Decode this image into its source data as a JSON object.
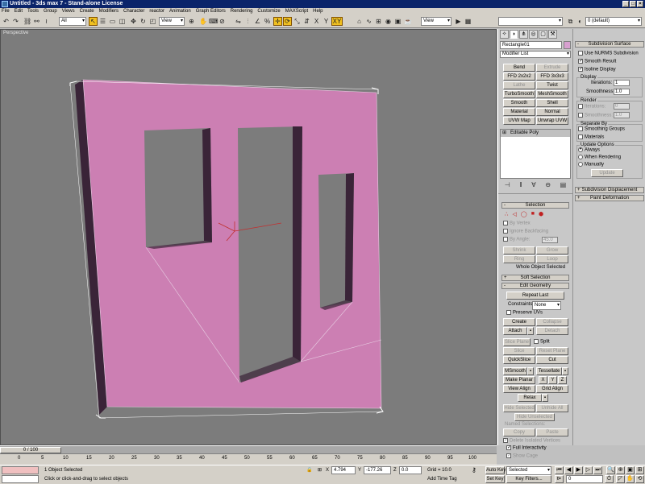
{
  "window": {
    "title": "Untitled - 3ds max 7 - Stand-alone License"
  },
  "menu": [
    "File",
    "Edit",
    "Tools",
    "Group",
    "Views",
    "Create",
    "Modifiers",
    "Character",
    "reactor",
    "Animation",
    "Graph Editors",
    "Rendering",
    "Customize",
    "MAXScript",
    "Help"
  ],
  "toolbar": {
    "filter": "All",
    "ref_coord": "View",
    "ref_coord2": "View",
    "layer": "0 (default)",
    "xy_label": "XY"
  },
  "viewport": {
    "label": "Perspective",
    "object_color": "#cc7fb3"
  },
  "command_panel": {
    "object_name": "Rectangle01",
    "modifier_list": "Modifier List",
    "buttons": [
      [
        "Bend",
        "Extrude"
      ],
      [
        "FFD 2x2x2",
        "FFD 3x3x3"
      ],
      [
        "Lathe",
        "Twist"
      ],
      [
        "TurboSmooth",
        "MeshSmooth"
      ],
      [
        "Smooth",
        "Shell"
      ],
      [
        "Material",
        "Normal"
      ],
      [
        "UVW Map",
        "Unwrap UVW"
      ]
    ],
    "stack_item": "Editable Poly",
    "selection": {
      "title": "Selection",
      "by_vertex": "By Vertex",
      "ignore_backfacing": "Ignore Backfacing",
      "by_angle": "By Angle:",
      "angle_value": "45.0",
      "shrink": "Shrink",
      "grow": "Grow",
      "ring": "Ring",
      "loop": "Loop",
      "status": "Whole Object Selected"
    },
    "soft_selection": "Soft Selection",
    "edit_geometry": {
      "title": "Edit Geometry",
      "repeat_last": "Repeat Last",
      "constraints_label": "Constraints:",
      "constraints_value": "None",
      "preserve_uvs": "Preserve UVs",
      "create": "Create",
      "collapse": "Collapse",
      "attach": "Attach",
      "detach": "Detach",
      "slice_plane": "Slice Plane",
      "split": "Split",
      "slice": "Slice",
      "reset_plane": "Reset Plane",
      "quickslice": "QuickSlice",
      "cut": "Cut",
      "msmooth": "MSmooth",
      "tessellate": "Tessellate",
      "make_planar": "Make Planar",
      "x": "X",
      "y": "Y",
      "z": "Z",
      "view_align": "View Align",
      "grid_align": "Grid Align",
      "relax": "Relax",
      "hide_selected": "Hide Selected",
      "unhide_all": "Unhide All",
      "hide_unselected": "Hide Unselected",
      "named_selections": "Named Selections:",
      "copy": "Copy",
      "paste": "Paste",
      "delete_isolated": "Delete Isolated Vertices",
      "full_interactivity": "Full Interactivity",
      "show_cage": "Show Cage"
    }
  },
  "right_panel": {
    "subdivision_surface": "Subdivision Surface",
    "use_nurms": "Use NURMS Subdivision",
    "smooth_result": "Smooth Result",
    "isoline_display": "Isoline Display",
    "display": "Display",
    "iterations_label": "Iterations:",
    "iterations_value": "1",
    "smoothness_label": "Smoothness:",
    "smoothness_value": "1.0",
    "render": "Render",
    "r_iterations_value": "0",
    "r_smoothness_value": "1.0",
    "separate_by": "Separate By",
    "smoothing_groups": "Smoothing Groups",
    "materials": "Materials",
    "update_options": "Update Options",
    "always": "Always",
    "when_rendering": "When Rendering",
    "manually": "Manually",
    "update": "Update",
    "subdivision_displacement": "Subdivision Displacement",
    "paint_deformation": "Paint Deformation"
  },
  "timeline": {
    "slider": "0 / 100",
    "ticks": [
      "0",
      "5",
      "10",
      "15",
      "20",
      "25",
      "30",
      "35",
      "40",
      "45",
      "50",
      "55",
      "60",
      "65",
      "70",
      "75",
      "80",
      "85",
      "90",
      "95",
      "100"
    ]
  },
  "status": {
    "selection": "1 Object Selected",
    "prompt": "Click or click-and-drag to select objects",
    "x_label": "X",
    "x_value": "4.794",
    "y_label": "Y",
    "y_value": "-177.26",
    "z_label": "Z",
    "z_value": "0.0",
    "grid": "Grid = 10.0",
    "add_time_tag": "Add Time Tag",
    "auto_key": "Auto Key",
    "set_key": "Set Key",
    "key_mode": "Selected",
    "key_filters": "Key Filters...",
    "frame": "0"
  }
}
